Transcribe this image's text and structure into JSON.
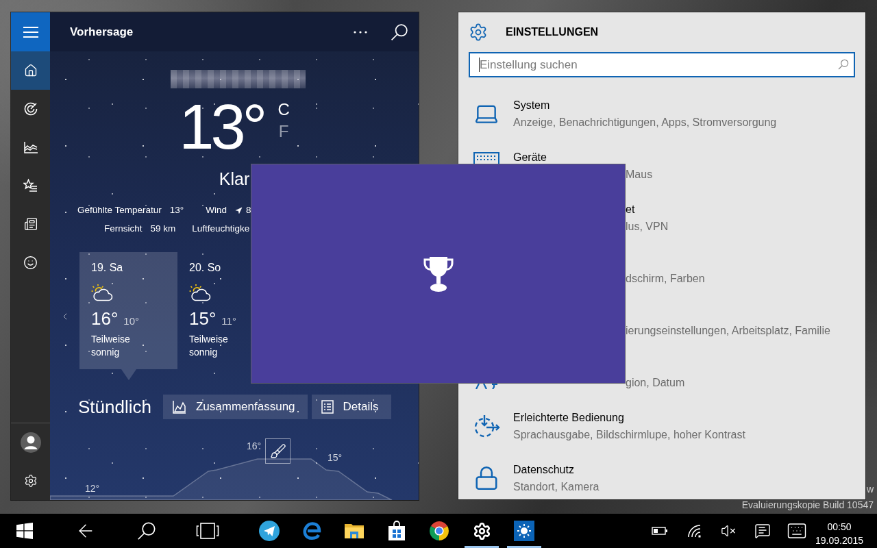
{
  "weather": {
    "title": "Vorhersage",
    "nav": [
      {
        "selected": true
      },
      {
        "selected": false
      },
      {
        "selected": false
      },
      {
        "selected": false
      },
      {
        "selected": false
      },
      {
        "selected": false
      }
    ],
    "current": {
      "temperature": "13°",
      "units": [
        {
          "label": "C",
          "selected": true
        },
        {
          "label": "F",
          "selected": false
        }
      ],
      "condition": "Klar"
    },
    "details": [
      {
        "items": [
          {
            "kind": "plain",
            "label": "Gefühlte Temperatur",
            "value": "13°"
          },
          {
            "kind": "direction",
            "label": "Wind",
            "value": "8"
          }
        ]
      },
      {
        "items": [
          {
            "kind": "plain",
            "label": "Fernsicht",
            "value": "59 km"
          },
          {
            "kind": "plain",
            "label": "Luftfeuchtigke"
          }
        ]
      }
    ],
    "days": [
      {
        "date": "19. Sa",
        "high": "16°",
        "low": "10°",
        "condition": "Teilweise sonnig",
        "selected": true
      },
      {
        "date": "20. So",
        "high": "15°",
        "low": "11°",
        "condition": "Teilweise sonnig",
        "selected": false
      }
    ],
    "hourly": {
      "title": "Stündlich",
      "views": [
        {
          "label": "Zusammenfassung"
        },
        {
          "label": "Details"
        }
      ],
      "graph_labels": [
        "16°",
        "15°",
        "12°"
      ]
    }
  },
  "settings": {
    "title": "EINSTELLUNGEN",
    "search": {
      "placeholder": "Einstellung suchen"
    },
    "categories": [
      {
        "kind": "full",
        "title": "System",
        "subtitle": "Anzeige, Benachrichtigungen, Apps, Stromversorgung"
      },
      {
        "kind": "cut-subtitle",
        "title": "Geräte",
        "subtitle": "Maus"
      },
      {
        "kind": "cut-both",
        "title": "et",
        "subtitle": "lus, VPN"
      },
      {
        "kind": "cut-subtitle",
        "subtitle": "dschirm, Farben"
      },
      {
        "kind": "cut-subtitle",
        "subtitle": "ierungseinstellungen, Arbeitsplatz, Familie"
      },
      {
        "kind": "cut-subtitle",
        "subtitle": "gion, Datum"
      },
      {
        "kind": "full",
        "title": "Erleichterte Bedienung",
        "subtitle": "Sprachausgabe, Bildschirmlupe, hoher Kontrast"
      },
      {
        "kind": "full",
        "title": "Datenschutz",
        "subtitle": "Standort, Kamera"
      }
    ]
  },
  "desktop": {
    "watermark": [
      "w",
      "Evaluierungskopie Build 10547"
    ]
  },
  "taskbar": {
    "apps": [
      {
        "running": false
      },
      {
        "running": false
      },
      {
        "running": false
      },
      {
        "running": false
      },
      {
        "running": false
      },
      {
        "running": true
      },
      {
        "running": true
      }
    ],
    "clock": {
      "time": "00:50",
      "date": "19.09.2015"
    }
  }
}
